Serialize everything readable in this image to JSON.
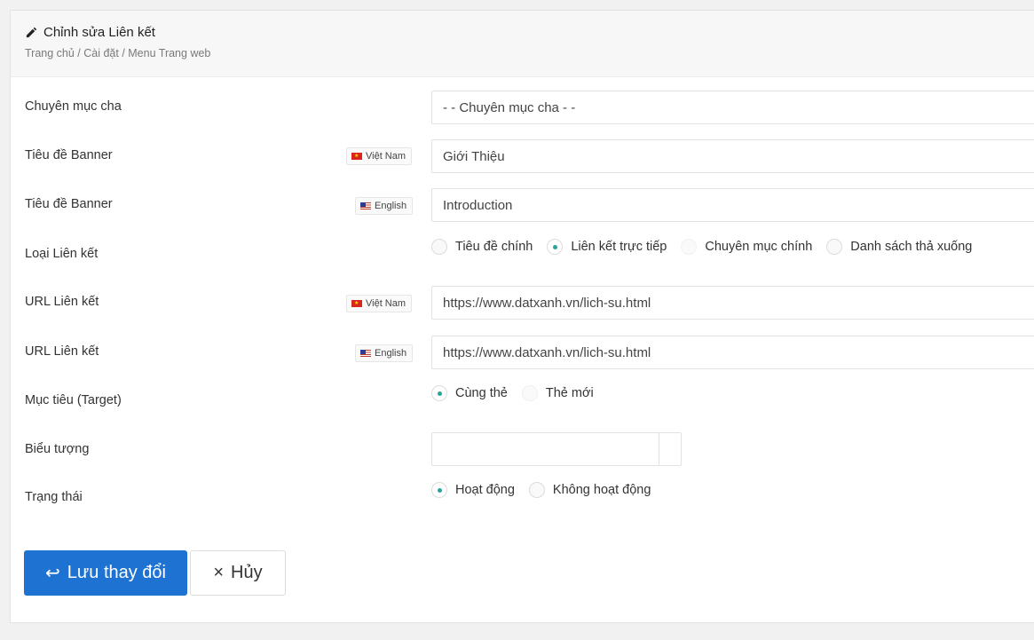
{
  "header": {
    "title": "Chỉnh sửa Liên kết",
    "breadcrumb": "Trang chủ / Cài đặt / Menu Trang web"
  },
  "languages": {
    "vi": "Việt Nam",
    "en": "English"
  },
  "form": {
    "parent_category": {
      "label": "Chuyên mục cha",
      "value": "- - Chuyên mục cha - -"
    },
    "banner_title_vi": {
      "label": "Tiêu đề Banner",
      "value": "Giới Thiệu"
    },
    "banner_title_en": {
      "label": "Tiêu đề Banner",
      "value": "Introduction"
    },
    "link_type": {
      "label": "Loại Liên kết",
      "options": [
        "Tiêu đề chính",
        "Liên kết trực tiếp",
        "Chuyên mục chính",
        "Danh sách thả xuống"
      ],
      "selected": "Liên kết trực tiếp"
    },
    "url_vi": {
      "label": "URL Liên kết",
      "value": "https://www.datxanh.vn/lich-su.html"
    },
    "url_en": {
      "label": "URL Liên kết",
      "value": "https://www.datxanh.vn/lich-su.html"
    },
    "target": {
      "label": "Mục tiêu (Target)",
      "options": [
        "Cùng thẻ",
        "Thẻ mới"
      ],
      "selected": "Cùng thẻ"
    },
    "icon": {
      "label": "Biểu tượng",
      "value": ""
    },
    "status": {
      "label": "Trạng thái",
      "options": [
        "Hoạt động",
        "Không hoạt động"
      ],
      "selected": "Hoạt động"
    }
  },
  "actions": {
    "save_icon": "↩",
    "save_label": "Lưu thay đổi",
    "cancel_icon": "×",
    "cancel_label": "Hủy"
  },
  "colors": {
    "primary": "#1e73d2",
    "radio_accent": "#26a69a"
  }
}
